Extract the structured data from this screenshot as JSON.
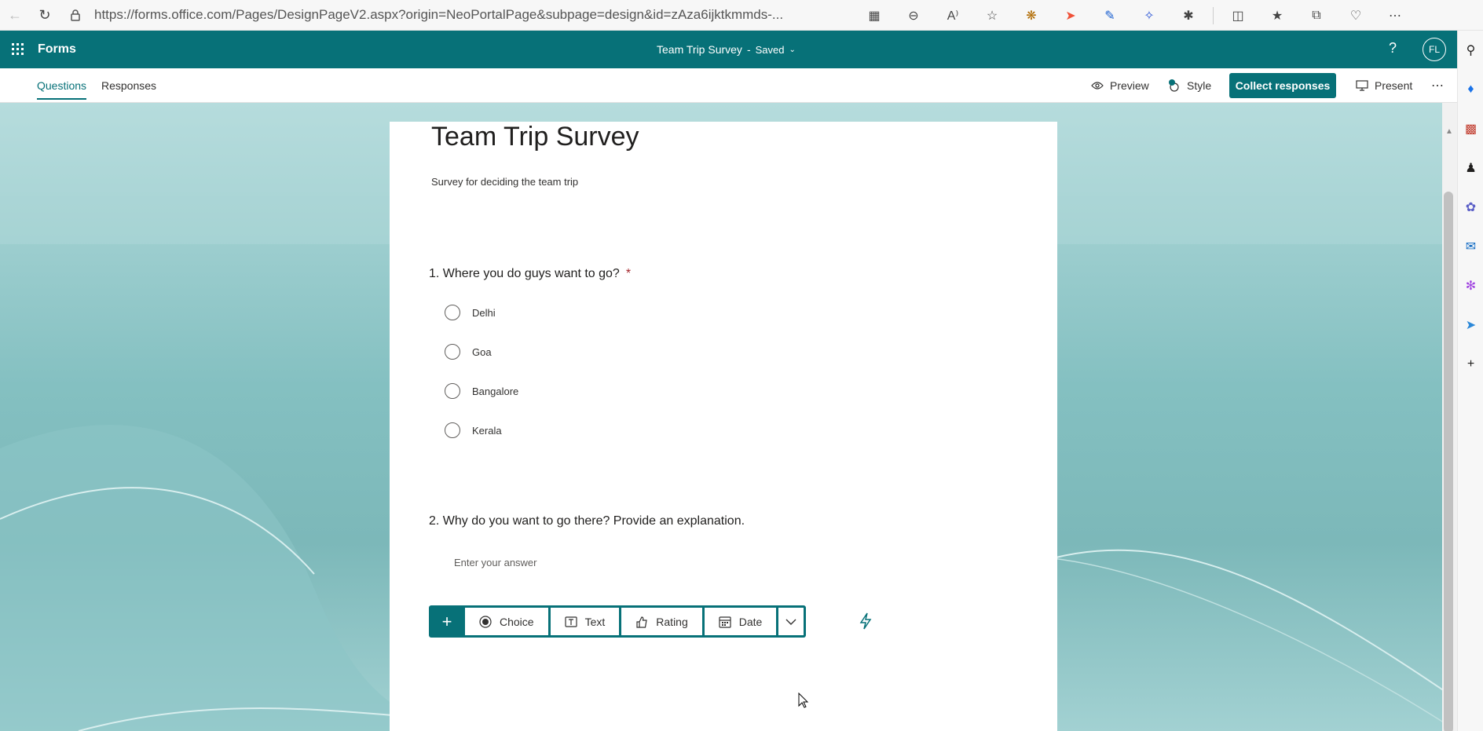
{
  "browser": {
    "url": "https://forms.office.com/Pages/DesignPageV2.aspx?origin=NeoPortalPage&subpage=design&id=zAza6ijktkmmds-..."
  },
  "app": {
    "name": "Forms",
    "doc_title": "Team Trip Survey",
    "separator": "-",
    "save_status": "Saved",
    "avatar_initials": "FL",
    "brand_color": "#077178"
  },
  "subnav": {
    "tabs": [
      "Questions",
      "Responses"
    ],
    "preview_label": "Preview",
    "style_label": "Style",
    "collect_label": "Collect responses",
    "present_label": "Present"
  },
  "form": {
    "title": "Team Trip Survey",
    "description": "Survey for deciding the team trip",
    "questions": [
      {
        "title": "1. Where you do guys want to go?",
        "required_mark": "*",
        "options": [
          "Delhi",
          "Goa",
          "Bangalore",
          "Kerala"
        ]
      },
      {
        "title": "2. Why do you want to go there? Provide an explanation.",
        "placeholder": "Enter your answer"
      }
    ]
  },
  "addbar": {
    "types": [
      "Choice",
      "Text",
      "Rating",
      "Date"
    ]
  },
  "icons": {
    "back": "back-arrow-icon",
    "refresh": "refresh-icon",
    "lock": "lock-icon",
    "waffle": "app-launcher-icon",
    "help": "help-icon",
    "preview": "eye-icon",
    "style": "palette-icon",
    "present": "monitor-icon",
    "more": "ellipsis-icon",
    "choice": "radio-icon",
    "text": "text-box-icon",
    "rating": "thumb-icon",
    "date": "calendar-icon",
    "bolt": "lightning-icon"
  }
}
